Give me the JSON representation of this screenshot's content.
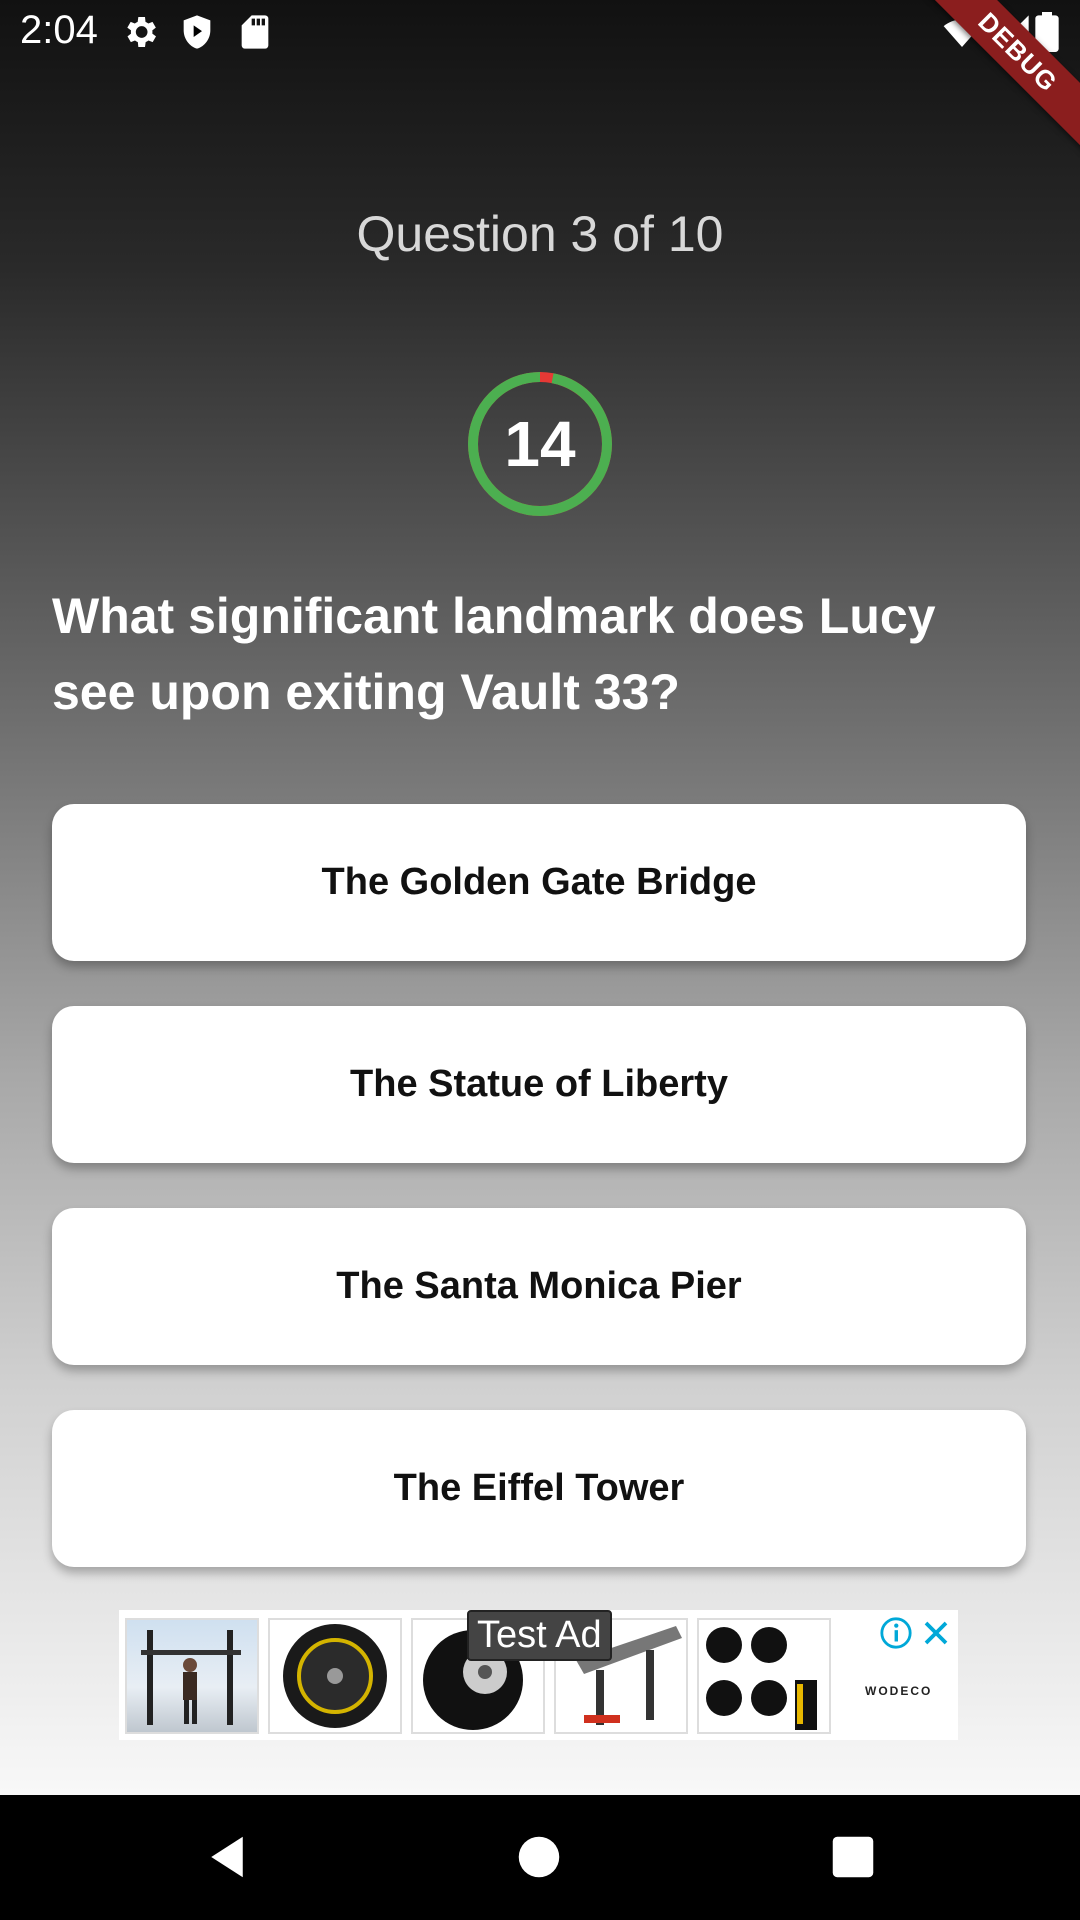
{
  "status_bar": {
    "time": "2:04",
    "left_icons": [
      "gear-icon",
      "shield-play-icon",
      "sd-card-icon"
    ],
    "right_icons": [
      "wifi-icon",
      "cell-signal-icon",
      "battery-icon"
    ],
    "debug_banner": "DEBUG"
  },
  "quiz": {
    "counter": "Question 3 of 10",
    "timer_value": "14",
    "timer_progress_fraction": 0.97,
    "question": "What significant landmark does Lucy see upon exiting Vault 33?",
    "answers": [
      {
        "label": "The Golden Gate Bridge"
      },
      {
        "label": "The Statue of Liberty"
      },
      {
        "label": "The Santa Monica Pier"
      },
      {
        "label": "The Eiffel Tower"
      }
    ]
  },
  "ad": {
    "label": "Test Ad",
    "brand": "WODECO",
    "info_icon": "info-icon",
    "close_icon": "close-icon"
  },
  "nav_bar": {
    "buttons": [
      "back-icon",
      "home-icon",
      "recents-icon"
    ]
  },
  "colors": {
    "timer_ring": "#4caf50",
    "timer_elapsed": "#e53935",
    "debug_banner": "#8b1e1e",
    "ad_icons": "#00a8d8"
  }
}
